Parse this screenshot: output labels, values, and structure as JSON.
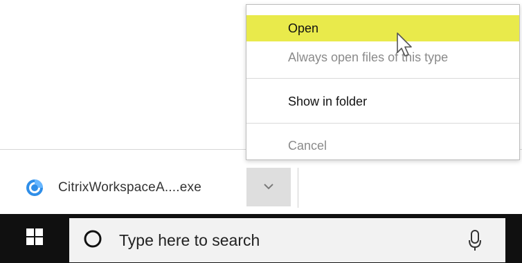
{
  "download_shelf": {
    "filename": "CitrixWorkspaceA....exe",
    "icon": "citrix-workspace-icon",
    "menu_button_icon": "chevron-down-icon"
  },
  "context_menu": {
    "items": [
      {
        "label": "Open",
        "highlighted": true
      },
      {
        "label": "Always open files of this type",
        "disabled": true
      },
      {
        "label": "Show in folder"
      },
      {
        "label": "Cancel"
      }
    ],
    "highlight_color": "#e9ea4b"
  },
  "taskbar": {
    "start_icon": "windows-logo-icon",
    "search_placeholder": "Type here to search",
    "search_icon": "cortana-circle-icon",
    "mic_icon": "microphone-icon",
    "background": "#101010"
  }
}
